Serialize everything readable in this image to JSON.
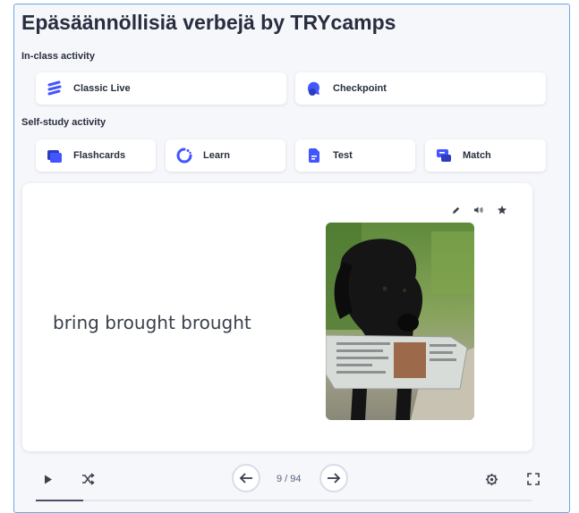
{
  "header": {
    "title": "Epäsäännöllisiä verbejä by TRYcamps"
  },
  "in_class": {
    "label": "In-class activity",
    "buttons": [
      {
        "label": "Classic Live",
        "icon": "classic-live-icon"
      },
      {
        "label": "Checkpoint",
        "icon": "checkpoint-icon"
      }
    ]
  },
  "self_study": {
    "label": "Self-study activity",
    "buttons": [
      {
        "label": "Flashcards",
        "icon": "flashcards-icon"
      },
      {
        "label": "Learn",
        "icon": "learn-icon"
      },
      {
        "label": "Test",
        "icon": "test-icon"
      },
      {
        "label": "Match",
        "icon": "match-icon"
      }
    ]
  },
  "card": {
    "term": "bring brought brought",
    "image": "dog-with-newspaper-photo",
    "tools": [
      "edit-icon",
      "audio-icon",
      "star-icon"
    ]
  },
  "controls": {
    "counter": "9 / 94",
    "current": 9,
    "total": 94,
    "buttons": [
      "play-icon",
      "shuffle-icon",
      "arrow-left-icon",
      "arrow-right-icon",
      "settings-icon",
      "fullscreen-icon"
    ]
  },
  "colors": {
    "accent": "#4255ff",
    "title": "#282e3e",
    "background": "#f6f7fb"
  }
}
